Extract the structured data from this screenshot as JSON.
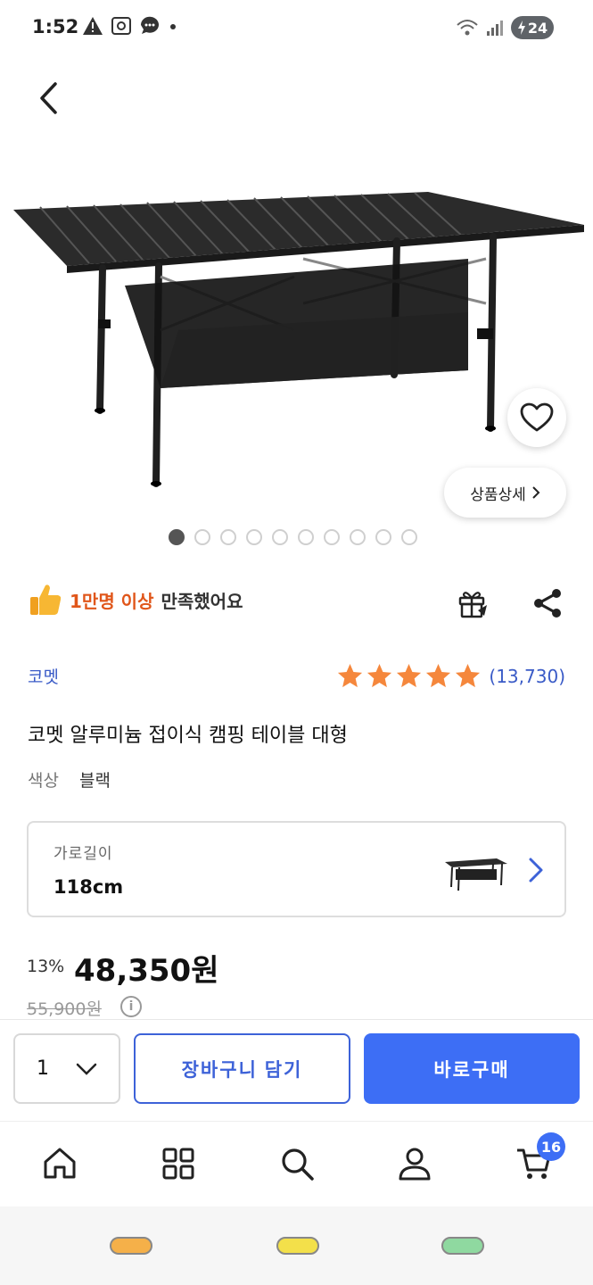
{
  "status_bar": {
    "time": "1:52",
    "battery": "24"
  },
  "product": {
    "detail_button_label": "상품상세",
    "image_count": 10,
    "active_image_index": 0
  },
  "satisfaction": {
    "highlight": "1만명 이상",
    "rest": "만족했어요"
  },
  "brand": "코멧",
  "rating": {
    "stars": 5,
    "review_count": "(13,730)",
    "star_color": "#f5873c"
  },
  "title": "코멧 알루미늄 접이식 캠핑 테이블 대형",
  "color": {
    "label": "색상",
    "value": "블랙"
  },
  "option": {
    "label": "가로길이",
    "value": "118cm"
  },
  "price": {
    "discount_rate": "13%",
    "sale_price": "48,350원",
    "original_price": "55,900원",
    "info_icon": "i"
  },
  "purchase_bar": {
    "quantity": "1",
    "cart_label": "장바구니 담기",
    "buy_label": "바로구매"
  },
  "bottom_nav": {
    "cart_count": "16",
    "items": [
      "home-icon",
      "category-icon",
      "search-icon",
      "user-icon",
      "cart-icon"
    ]
  },
  "colors": {
    "accent": "#3d6ef5",
    "brand_link": "#3a5bc7",
    "satisfaction": "#e0561a"
  }
}
